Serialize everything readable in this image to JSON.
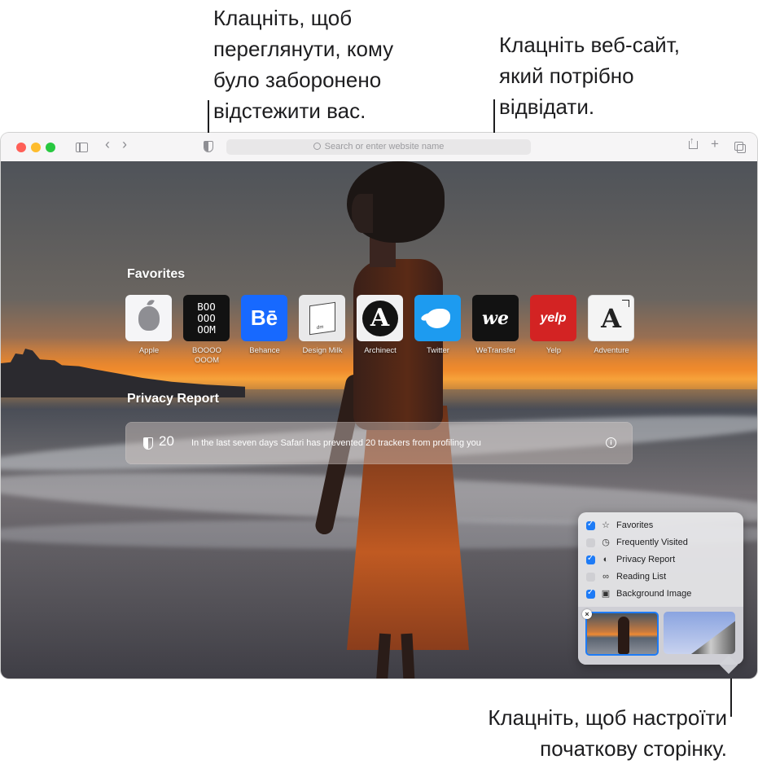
{
  "annotations": {
    "privacy": "Клацніть, щоб\nпереглянути, кому\nбуло заборонено\nвідстежити вас.",
    "website": "Клацніть веб-сайт,\nякий потрібно\nвідвідати.",
    "customize": "Клацніть, щоб настроїти\nпочаткову сторінку."
  },
  "toolbar": {
    "address_placeholder": "Search or enter website name"
  },
  "favorites": {
    "title": "Favorites",
    "items": [
      {
        "label": "Apple",
        "icon": "apple-logo-icon"
      },
      {
        "label": "BOOOO\nOOOM",
        "icon": "boooooom-logo-icon",
        "tile_text": "BOO\nOOO\nOOM"
      },
      {
        "label": "Behance",
        "icon": "behance-logo-icon",
        "tile_text": "Bē"
      },
      {
        "label": "Design Milk",
        "icon": "design-milk-logo-icon",
        "tile_text": "dm"
      },
      {
        "label": "Archinect",
        "icon": "archinect-logo-icon",
        "tile_text": "A"
      },
      {
        "label": "Twitter",
        "icon": "twitter-bird-icon"
      },
      {
        "label": "WeTransfer",
        "icon": "wetransfer-logo-icon",
        "tile_text": "we"
      },
      {
        "label": "Yelp",
        "icon": "yelp-logo-icon",
        "tile_text": "yelp"
      },
      {
        "label": "Adventure",
        "icon": "adventure-logo-icon",
        "tile_text": "A"
      }
    ]
  },
  "privacy_report": {
    "title": "Privacy Report",
    "count": "20",
    "message": "In the last seven days Safari has prevented 20 trackers from profiling you"
  },
  "customize_menu": {
    "options": [
      {
        "label": "Favorites",
        "checked": true,
        "icon": "star-icon"
      },
      {
        "label": "Frequently Visited",
        "checked": false,
        "icon": "clock-icon"
      },
      {
        "label": "Privacy Report",
        "checked": true,
        "icon": "shield-icon"
      },
      {
        "label": "Reading List",
        "checked": false,
        "icon": "glasses-icon"
      },
      {
        "label": "Background Image",
        "checked": true,
        "icon": "image-icon"
      }
    ]
  },
  "colors": {
    "accent": "#1e7bf6",
    "traffic_red": "#ff5f57",
    "traffic_yellow": "#febc2e",
    "traffic_green": "#28c840"
  }
}
